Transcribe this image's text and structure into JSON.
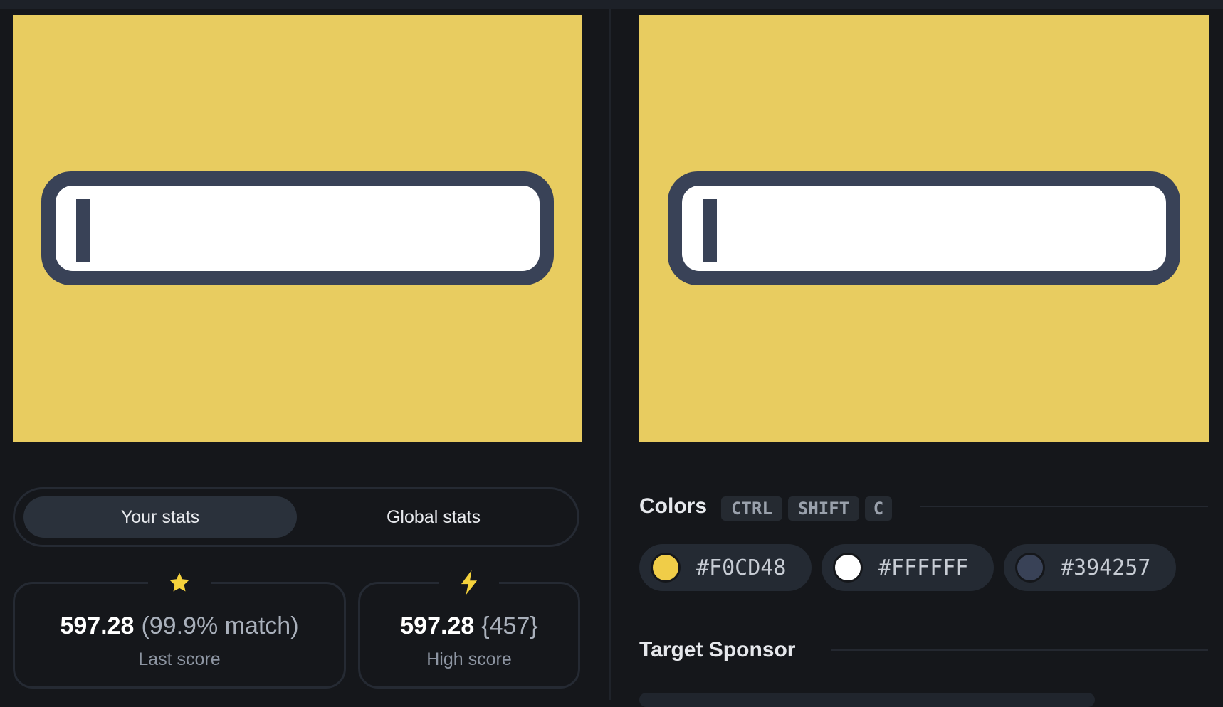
{
  "target": {
    "background_color": "#F0CD48",
    "field_border_color": "#394257",
    "field_fill_color": "#FFFFFF"
  },
  "stats_tabs": [
    {
      "label": "Your stats",
      "active": true
    },
    {
      "label": "Global stats",
      "active": false
    }
  ],
  "last_score": {
    "icon": "star-icon",
    "icon_color": "#F5D23C",
    "value": "597.28",
    "detail": "(99.9% match)",
    "label": "Last score"
  },
  "high_score": {
    "icon": "lightning-icon",
    "icon_color": "#F5D23C",
    "value": "597.28",
    "detail": "{457}",
    "label": "High score"
  },
  "colors_section": {
    "title": "Colors",
    "shortcut_keys": [
      "CTRL",
      "SHIFT",
      "C"
    ],
    "swatches": [
      {
        "hex": "#F0CD48"
      },
      {
        "hex": "#FFFFFF"
      },
      {
        "hex": "#394257"
      }
    ]
  },
  "sponsor_section": {
    "title": "Target Sponsor"
  }
}
